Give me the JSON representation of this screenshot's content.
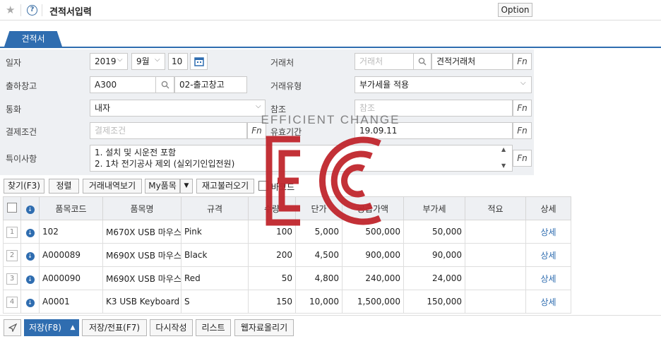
{
  "header": {
    "title": "견적서입력",
    "option_label": "Option"
  },
  "tab": {
    "label": "견적서"
  },
  "form": {
    "date_label": "일자",
    "year": "2019",
    "month": "9월",
    "day": "10",
    "customer_label": "거래처",
    "customer_placeholder": "거래처",
    "customer_name": "견적거래처",
    "warehouse_label": "출하창고",
    "warehouse_code": "A300",
    "warehouse_name": "02-출고창고",
    "trade_type_label": "거래유형",
    "trade_type_value": "부가세율 적용",
    "currency_label": "통화",
    "currency_value": "내자",
    "reference_label": "참조",
    "reference_placeholder": "참조",
    "payment_label": "결제조건",
    "payment_placeholder": "결제조건",
    "validity_label": "유효기간",
    "validity_value": "19.09.11",
    "notes_label": "특이사항",
    "notes_line1": "1. 설치 및 시운전 포함",
    "notes_line2": "2. 1차 전기공사 제외 (실외기인입전원)",
    "fn_label": "Fn"
  },
  "toolbar": {
    "find": "찾기(F3)",
    "sort": "정렬",
    "history": "거래내역보기",
    "my_items": "My품목",
    "stock": "재고불러오기",
    "checkbox_label": "바코드"
  },
  "grid": {
    "headers": [
      "품목코드",
      "품목명",
      "규격",
      "수량",
      "단가",
      "공급가액",
      "부가세",
      "적요",
      "상세"
    ],
    "rows": [
      {
        "no": "1",
        "code": "102",
        "name": "M670X USB 마우스",
        "spec": "Pink",
        "qty": "100",
        "price": "5,000",
        "supply": "500,000",
        "vat": "50,000",
        "memo": "",
        "detail": "상세"
      },
      {
        "no": "2",
        "code": "A000089",
        "name": "M690X USB 마우스",
        "spec": "Black",
        "qty": "200",
        "price": "4,500",
        "supply": "900,000",
        "vat": "90,000",
        "memo": "",
        "detail": "상세"
      },
      {
        "no": "3",
        "code": "A000090",
        "name": "M690X USB 마우스",
        "spec": "Red",
        "qty": "50",
        "price": "4,800",
        "supply": "240,000",
        "vat": "24,000",
        "memo": "",
        "detail": "상세"
      },
      {
        "no": "4",
        "code": "A0001",
        "name": "K3 USB Keyboard",
        "spec": "S",
        "qty": "150",
        "price": "10,000",
        "supply": "1,500,000",
        "vat": "150,000",
        "memo": "",
        "detail": "상세"
      }
    ]
  },
  "bottom": {
    "save": "저장(F8)",
    "save_slip": "저장/전표(F7)",
    "rewrite": "다시작성",
    "list": "리스트",
    "web_upload": "웹자료올리기"
  },
  "watermark": {
    "text": "EFFICIENT CHANGE",
    "color": "#c0262d"
  },
  "colors": {
    "accent": "#2f6db0",
    "form_bg": "#eef0f3"
  }
}
